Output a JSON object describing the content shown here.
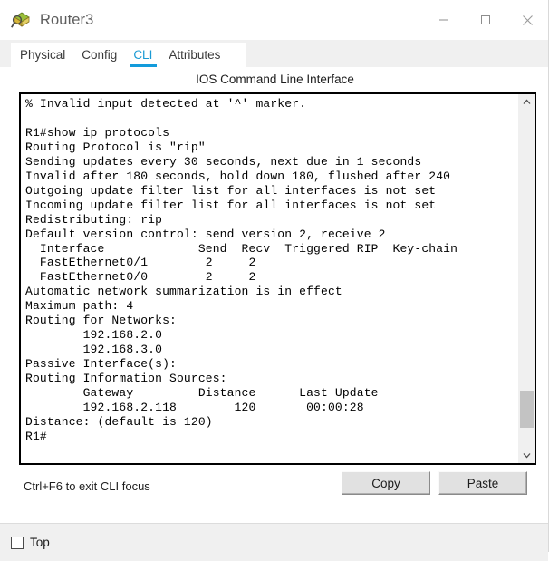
{
  "window": {
    "title": "Router3",
    "icon": "router-device-icon",
    "controls": {
      "minimize": "minimize-button",
      "maximize": "maximize-button",
      "close": "close-button"
    }
  },
  "tabs": {
    "items": [
      {
        "label": "Physical",
        "active": false
      },
      {
        "label": "Config",
        "active": false
      },
      {
        "label": "CLI",
        "active": true
      },
      {
        "label": "Attributes",
        "active": false
      }
    ],
    "active_color": "#139bdb"
  },
  "panel": {
    "title": "IOS Command Line Interface"
  },
  "terminal": {
    "lines": [
      "% Invalid input detected at '^' marker.",
      "",
      "R1#show ip protocols",
      "Routing Protocol is \"rip\"",
      "Sending updates every 30 seconds, next due in 1 seconds",
      "Invalid after 180 seconds, hold down 180, flushed after 240",
      "Outgoing update filter list for all interfaces is not set",
      "Incoming update filter list for all interfaces is not set",
      "Redistributing: rip",
      "Default version control: send version 2, receive 2",
      "  Interface             Send  Recv  Triggered RIP  Key-chain",
      "  FastEthernet0/1        2     2",
      "  FastEthernet0/0        2     2",
      "Automatic network summarization is in effect",
      "Maximum path: 4",
      "Routing for Networks:",
      "        192.168.2.0",
      "        192.168.3.0",
      "Passive Interface(s):",
      "Routing Information Sources:",
      "        Gateway         Distance      Last Update",
      "        192.168.2.118        120       00:00:28",
      "Distance: (default is 120)",
      "R1#"
    ],
    "background": "#ffffff",
    "text_color": "#000000"
  },
  "scrollbar": {
    "up_arrow": "chevron-up-icon",
    "down_arrow": "chevron-down-icon",
    "thumb_top_pct": 83,
    "thumb_height_pct": 11
  },
  "footer": {
    "hint": "Ctrl+F6 to exit CLI focus",
    "copy_label": "Copy",
    "paste_label": "Paste"
  },
  "bottom": {
    "top_checkbox_label": "Top",
    "top_checkbox_checked": false
  }
}
